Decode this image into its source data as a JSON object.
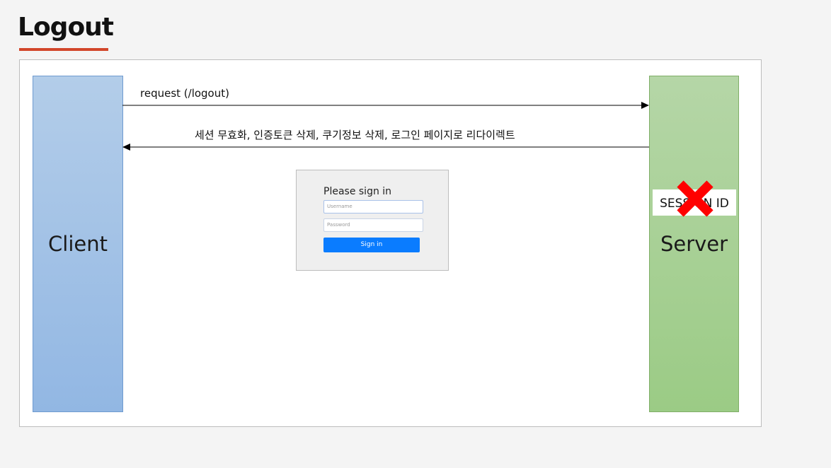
{
  "page": {
    "title": "Logout",
    "accent_color": "#d2462a"
  },
  "diagram": {
    "client_label": "Client",
    "server_label": "Server",
    "request_message": "request (/logout)",
    "response_message": "세션 무효화,  인증토큰 삭제, 쿠기정보 삭제, 로그인 페이지로 리다이렉트",
    "session_label": "SESSION ID",
    "session_invalidated_icon": "x-mark-icon",
    "x_mark_color": "#ff0000",
    "client_color": "#9dbde6",
    "server_color": "#a7d092"
  },
  "signin_form": {
    "title": "Please sign in",
    "username_placeholder": "Username",
    "password_placeholder": "Password",
    "button_label": "Sign in",
    "button_color": "#0a7cff"
  }
}
